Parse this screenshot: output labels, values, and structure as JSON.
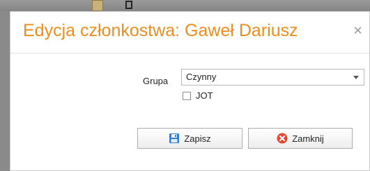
{
  "dialog": {
    "title": "Edycja członkostwa: Gaweł Dariusz",
    "close_glyph": "×"
  },
  "form": {
    "group_label": "Grupa",
    "group_value": "Czynny",
    "jot_label": "JOT",
    "jot_checked": false
  },
  "buttons": {
    "save_label": "Zapisz",
    "close_label": "Zamknij"
  },
  "icons": {
    "save": "floppy-disk-icon",
    "close": "red-x-icon",
    "dropdown": "chevron-down-icon"
  },
  "colors": {
    "title": "#f08c1e",
    "close_icon": "#e8452c",
    "save_icon": "#2c7fd4"
  }
}
